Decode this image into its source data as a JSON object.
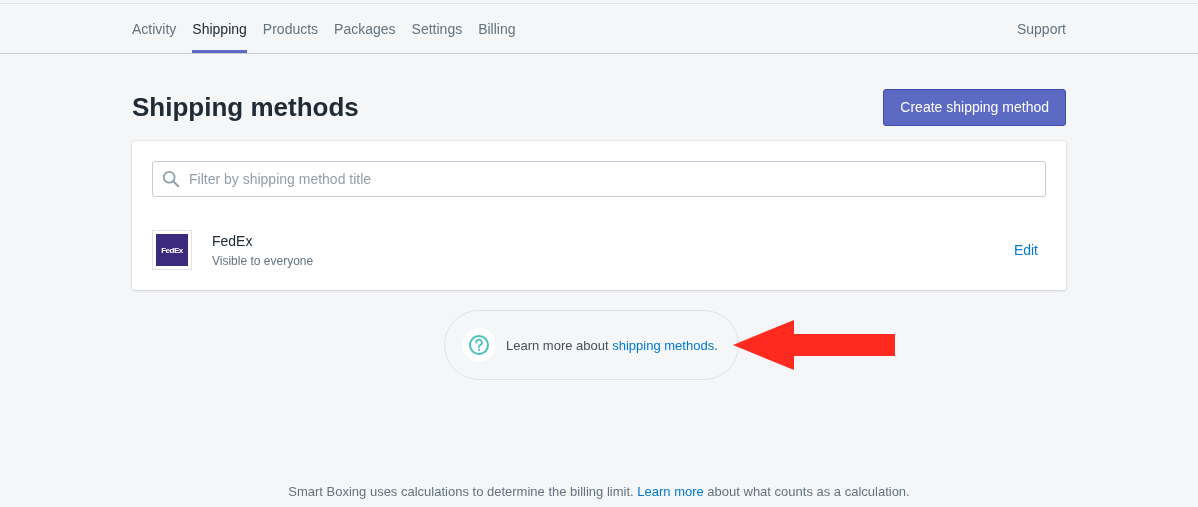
{
  "nav": {
    "tabs": [
      {
        "label": "Activity",
        "selected": false
      },
      {
        "label": "Shipping",
        "selected": true
      },
      {
        "label": "Products",
        "selected": false
      },
      {
        "label": "Packages",
        "selected": false
      },
      {
        "label": "Settings",
        "selected": false
      },
      {
        "label": "Billing",
        "selected": false
      }
    ],
    "support": "Support"
  },
  "header": {
    "title": "Shipping methods",
    "button": "Create shipping method"
  },
  "search": {
    "placeholder": "Filter by shipping method title"
  },
  "methods": [
    {
      "logo_text": "FedEx",
      "name": "FedEx",
      "visibility": "Visible to everyone",
      "action": "Edit"
    }
  ],
  "callout": {
    "prefix": "Learn more about ",
    "link": "shipping methods",
    "suffix": "."
  },
  "footer": {
    "prefix": "Smart Boxing uses calculations to determine the billing limit. ",
    "link": "Learn more",
    "suffix": " about what counts as a calculation."
  }
}
